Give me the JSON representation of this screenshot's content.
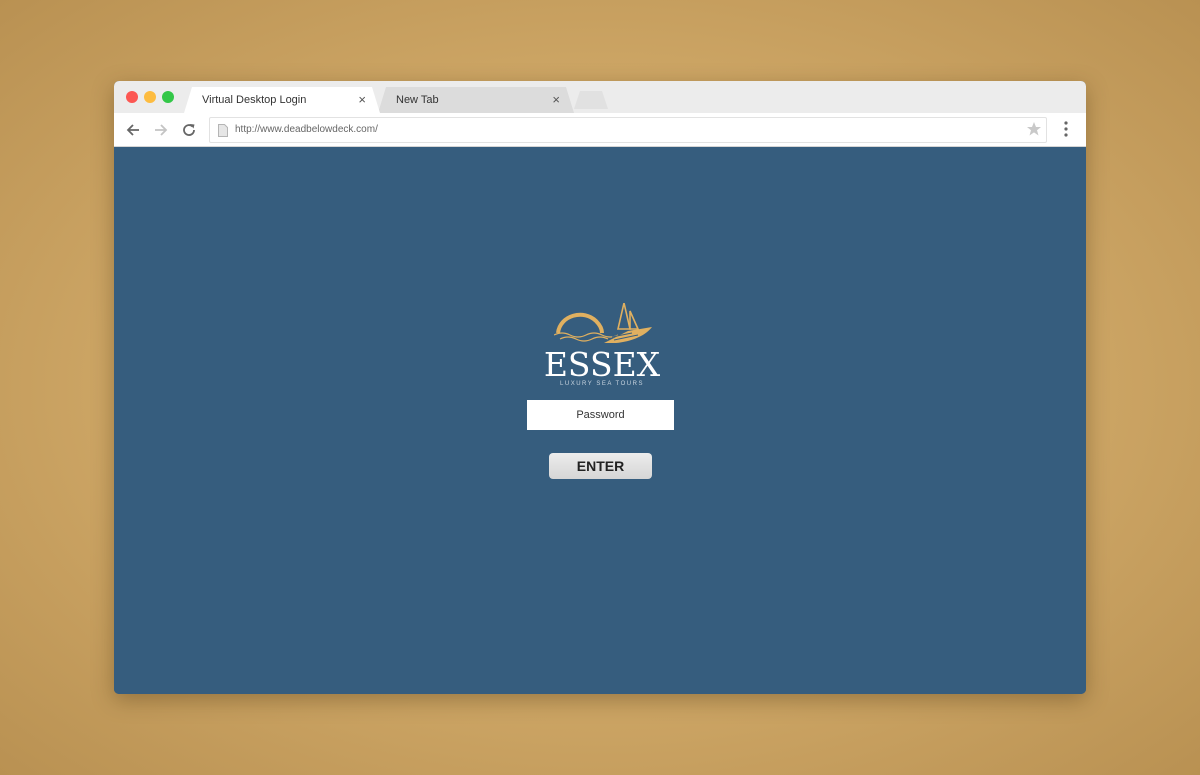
{
  "browser": {
    "tabs": [
      {
        "label": "Virtual Desktop Login",
        "close": "×",
        "active": true
      },
      {
        "label": "New Tab",
        "close": "×",
        "active": false
      }
    ],
    "url": "http://www.deadbelowdeck.com/"
  },
  "page": {
    "logo": {
      "wordmark": "ESSEX",
      "tagline": "LUXURY SEA TOURS"
    },
    "password": {
      "placeholder": "Password",
      "value": ""
    },
    "enter_label": "ENTER"
  },
  "colors": {
    "page_background": "#365d7e",
    "logo_gold": "#e0b060",
    "desk_background": "#d2ab6a"
  },
  "icons": [
    "back-arrow-icon",
    "forward-arrow-icon",
    "reload-icon",
    "page-icon",
    "star-icon",
    "more-vert-icon"
  ]
}
